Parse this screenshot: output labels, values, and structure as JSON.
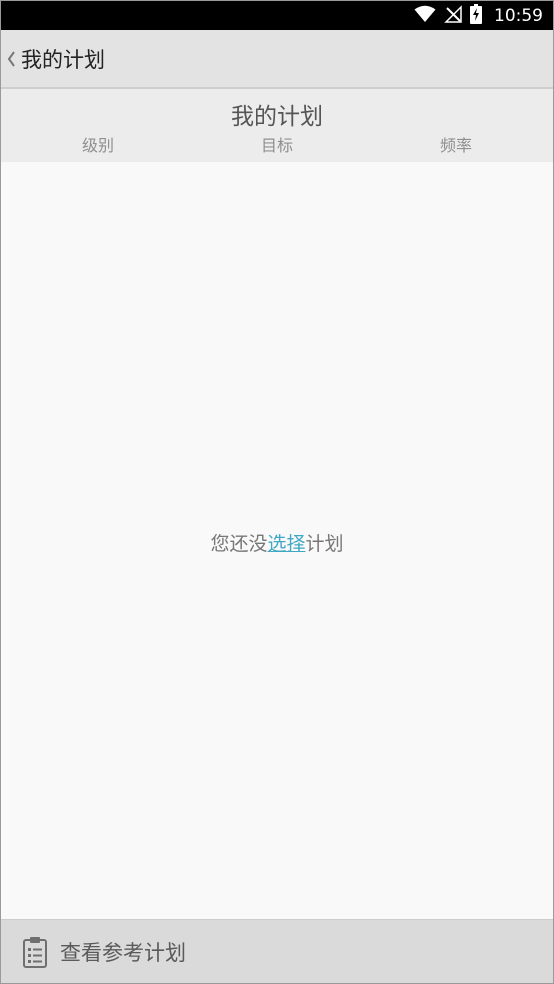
{
  "status_bar": {
    "time": "10:59",
    "icons": [
      "wifi-icon",
      "no-signal-icon",
      "battery-charging-icon"
    ]
  },
  "app_bar": {
    "back_icon": "chevron-left-icon",
    "title": "我的计划"
  },
  "plan_header": {
    "title": "我的计划",
    "columns": [
      "级别",
      "目标",
      "频率"
    ]
  },
  "main": {
    "empty_prefix": "您还没",
    "empty_link": "选择",
    "empty_suffix": "计划"
  },
  "bottom_bar": {
    "icon": "clipboard-icon",
    "label": "查看参考计划"
  },
  "colors": {
    "link": "#3fa8c5",
    "app_bar_bg": "#e3e3e3",
    "header_bg": "#ececec",
    "main_bg": "#f9f9f9",
    "bottom_bar_bg": "#dadada"
  }
}
